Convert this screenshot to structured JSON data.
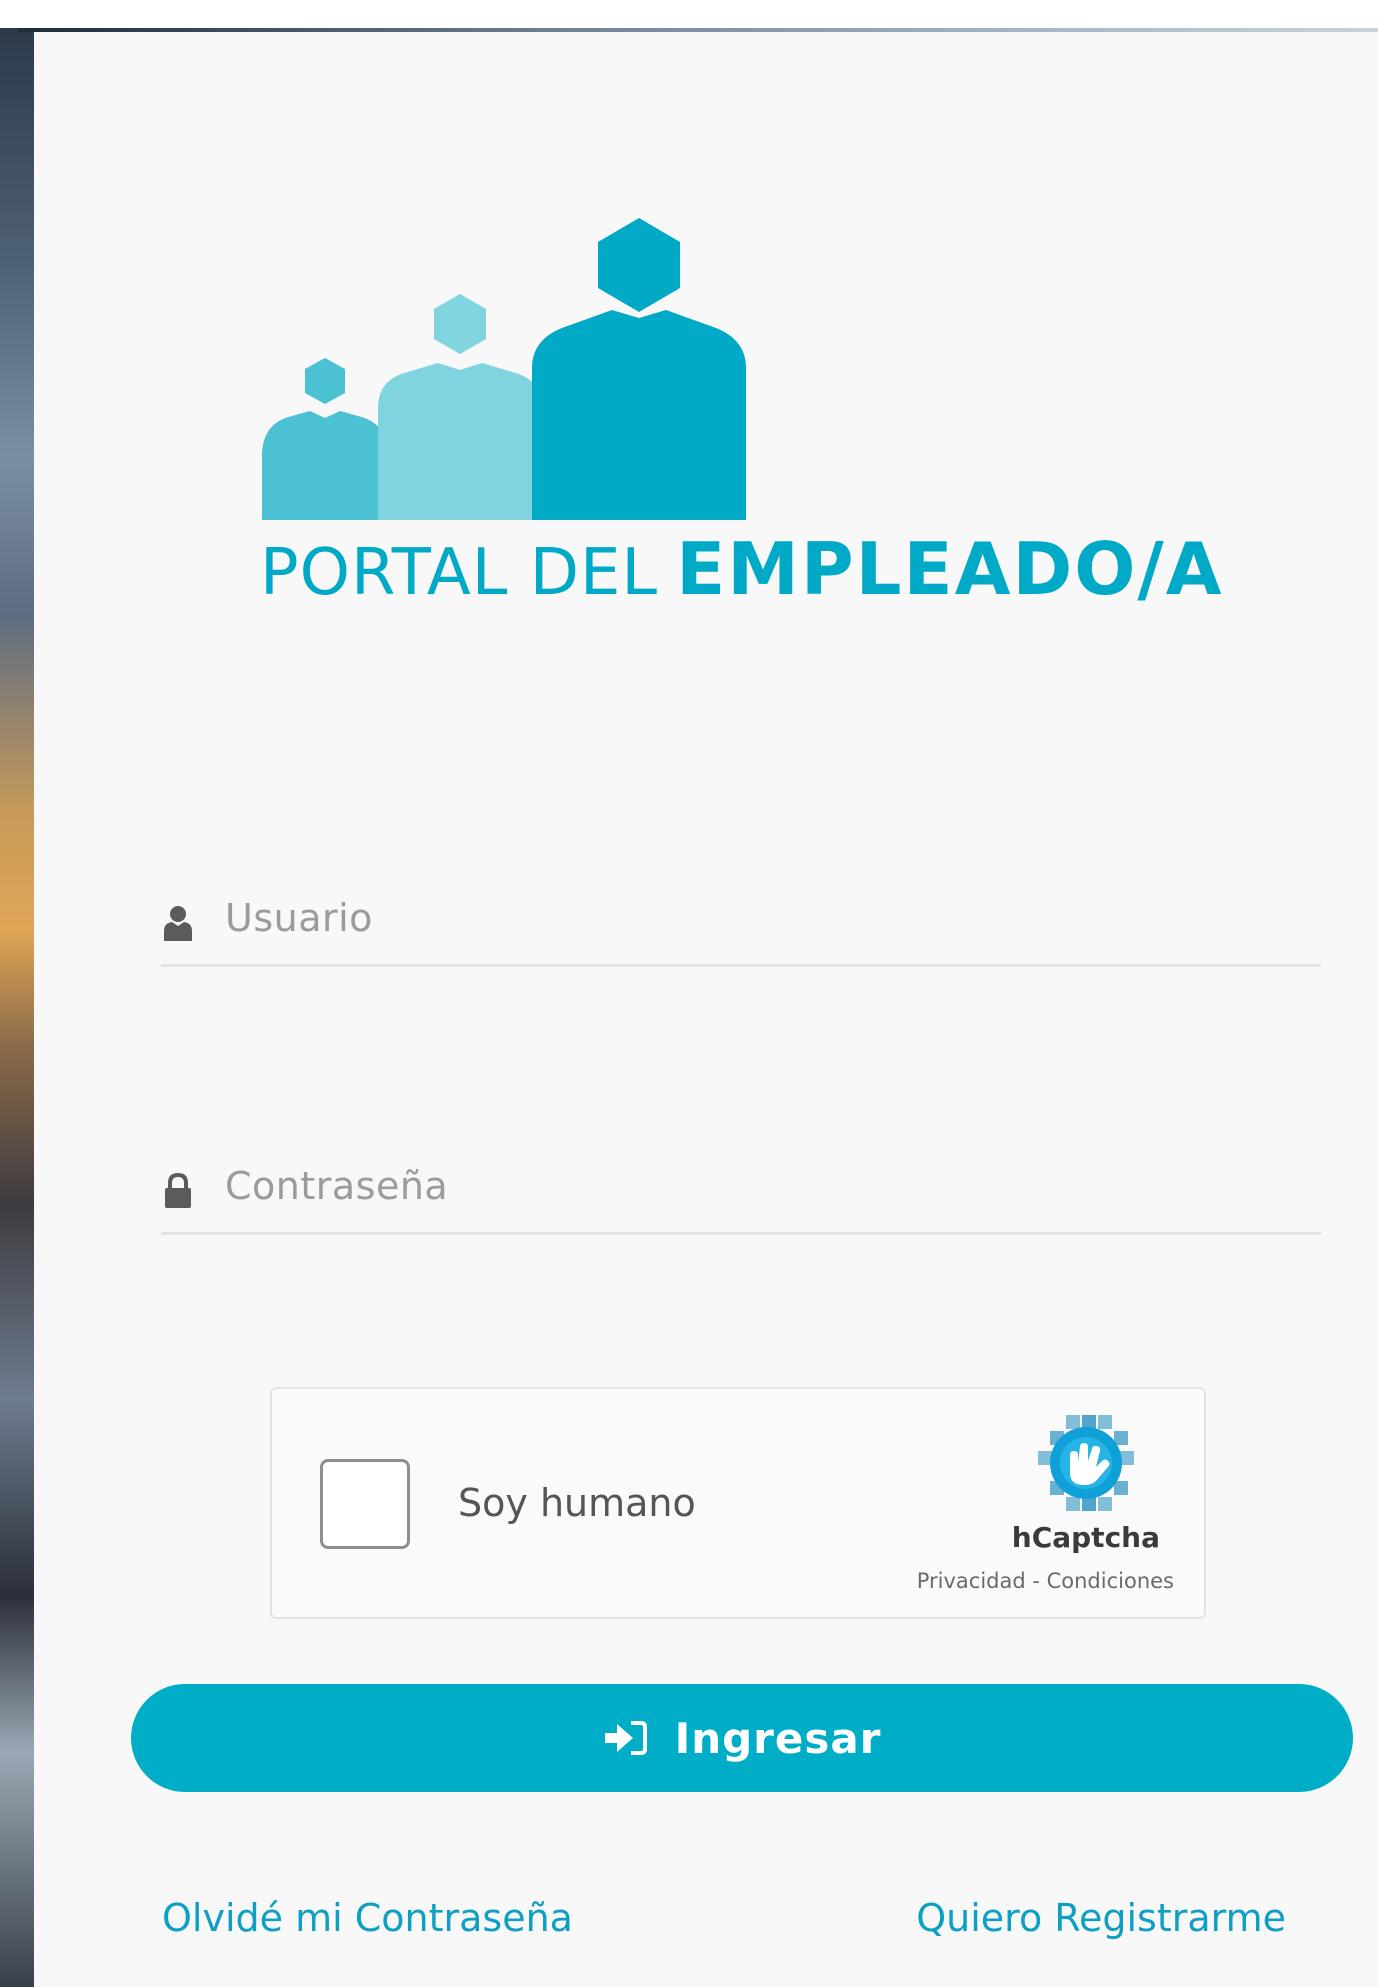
{
  "logo": {
    "text_light": "PORTAL DEL",
    "text_bold": "EMPLEADO/A",
    "color": "#00a9c6",
    "icon": "people-hexagon-logo-icon"
  },
  "login_form": {
    "username": {
      "placeholder": "Usuario",
      "value": "",
      "icon": "user-icon"
    },
    "password": {
      "placeholder": "Contraseña",
      "value": "",
      "icon": "lock-icon"
    }
  },
  "captcha": {
    "checkbox_label": "Soy humano",
    "checked": false,
    "brand": "hCaptcha",
    "links": "Privacidad - Condiciones",
    "icon": "hcaptcha-hand-icon"
  },
  "submit": {
    "label": "Ingresar",
    "icon": "sign-in-icon",
    "color": "#00adc7"
  },
  "links": {
    "forgot_password": "Olvidé mi Contraseña",
    "register": "Quiero Registrarme",
    "color": "#0f9fc4"
  }
}
